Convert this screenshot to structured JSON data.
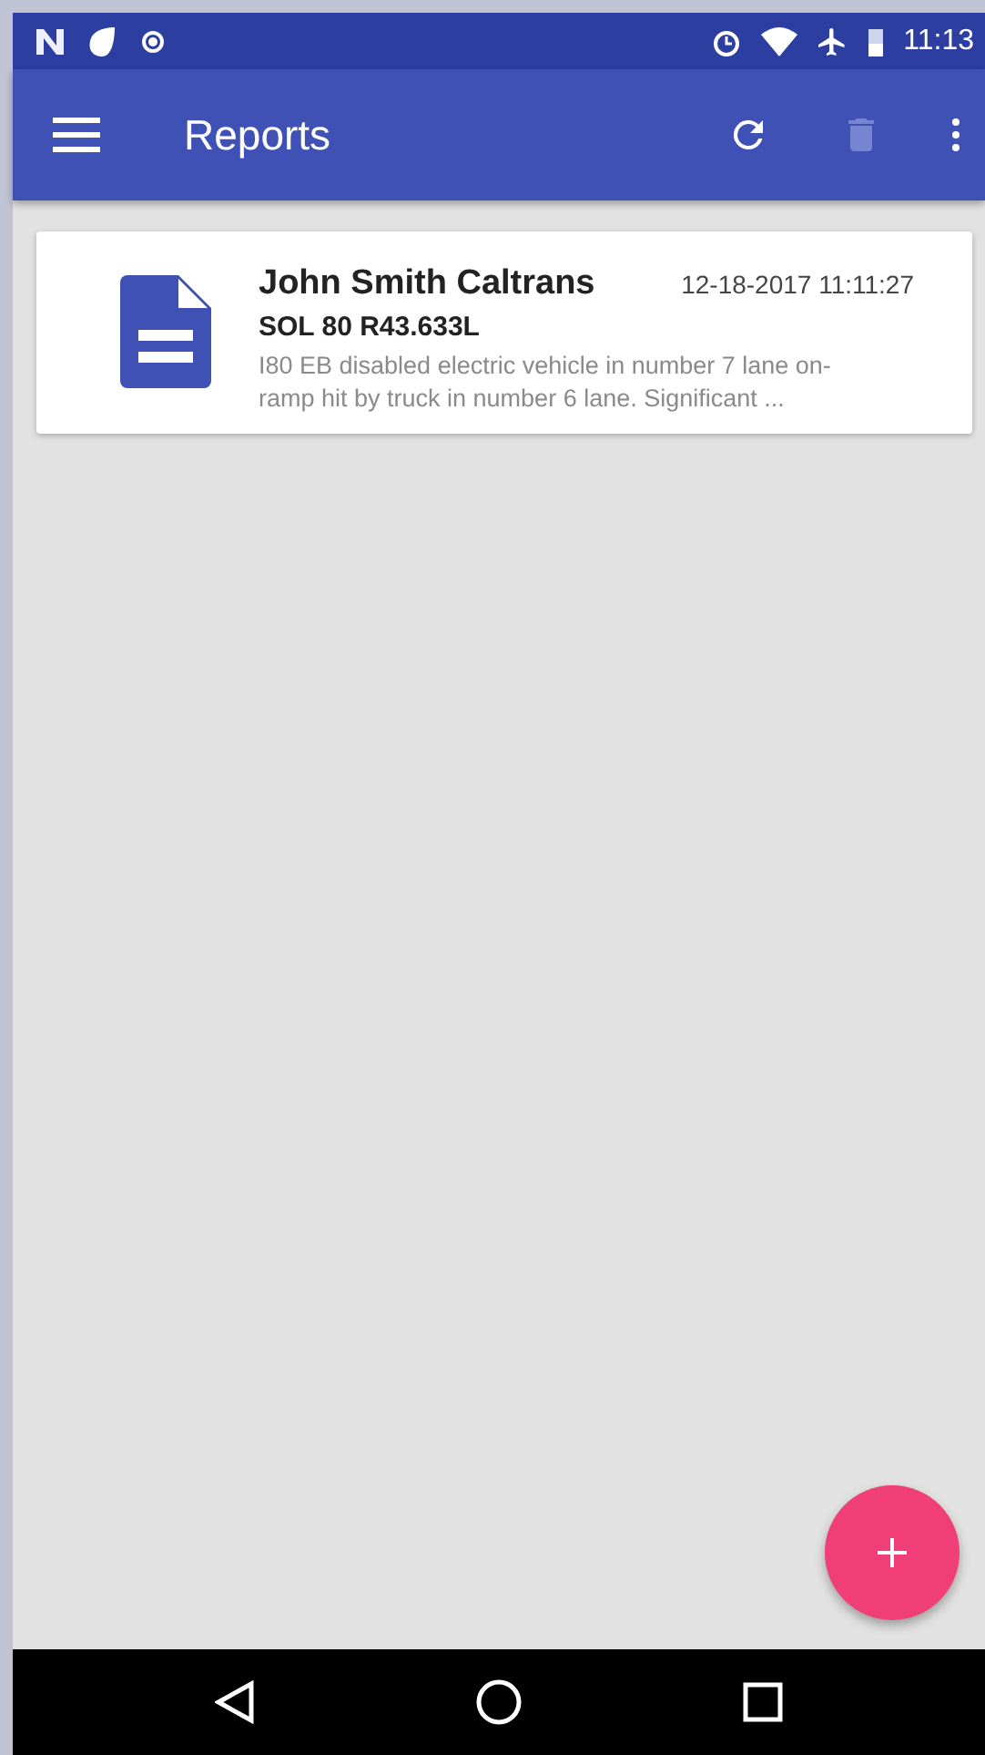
{
  "status_bar": {
    "time": "11:13"
  },
  "toolbar": {
    "title": "Reports",
    "actions": [
      {
        "kind": "refresh",
        "disabled": false
      },
      {
        "kind": "delete",
        "disabled": true
      },
      {
        "kind": "more",
        "disabled": false
      }
    ]
  },
  "reports": [
    {
      "author": "John Smith Caltrans",
      "timestamp": "12-18-2017 11:11:27",
      "location": "SOL 80 R43.633L",
      "description": "I80 EB disabled electric vehicle in number 7 lane on-ramp hit by truck in number 6 lane. Significant ..."
    }
  ]
}
